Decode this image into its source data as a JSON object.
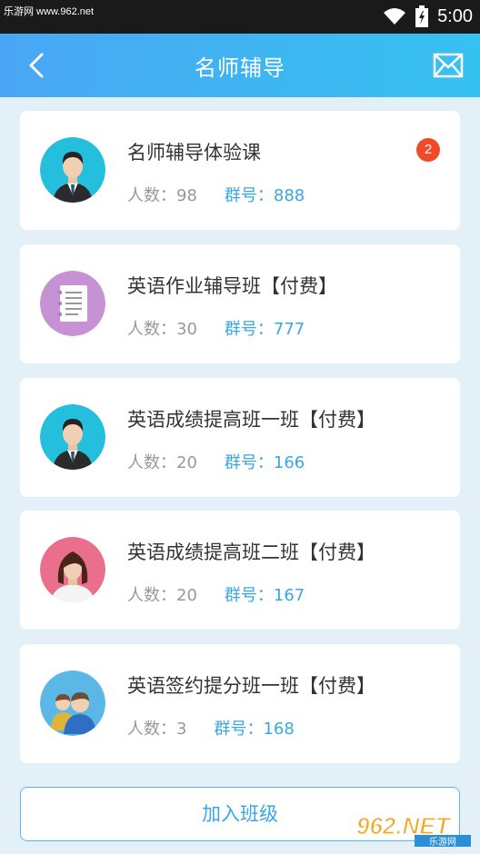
{
  "status_bar": {
    "watermark": "乐游网 www.962.net",
    "time": "5:00"
  },
  "header": {
    "title": "名师辅导",
    "back_icon": "chevron-left-icon",
    "mail_icon": "envelope-icon"
  },
  "groups": [
    {
      "title": "名师辅导体验课",
      "members_label": "人数：98",
      "group_label": "群号：888",
      "avatar": "male-teacher-avatar",
      "badge": "2"
    },
    {
      "title": "英语作业辅导班【付费】",
      "members_label": "人数：30",
      "group_label": "群号：777",
      "avatar": "notebook-avatar"
    },
    {
      "title": "英语成绩提高班一班【付费】",
      "members_label": "人数：20",
      "group_label": "群号：166",
      "avatar": "male-teacher-avatar"
    },
    {
      "title": "英语成绩提高班二班【付费】",
      "members_label": "人数：20",
      "group_label": "群号：167",
      "avatar": "female-teacher-avatar"
    },
    {
      "title": "英语签约提分班一班【付费】",
      "members_label": "人数：3",
      "group_label": "群号：168",
      "avatar": "group-avatar"
    }
  ],
  "join_button": "加入班级",
  "watermark_logo": {
    "main": "962.NET",
    "sub": "乐游网"
  },
  "colors": {
    "header_start": "#4aa6f4",
    "header_end": "#36c2f0",
    "accent": "#3aa6e6",
    "badge": "#f04a2b",
    "background": "#e3f0f8"
  }
}
